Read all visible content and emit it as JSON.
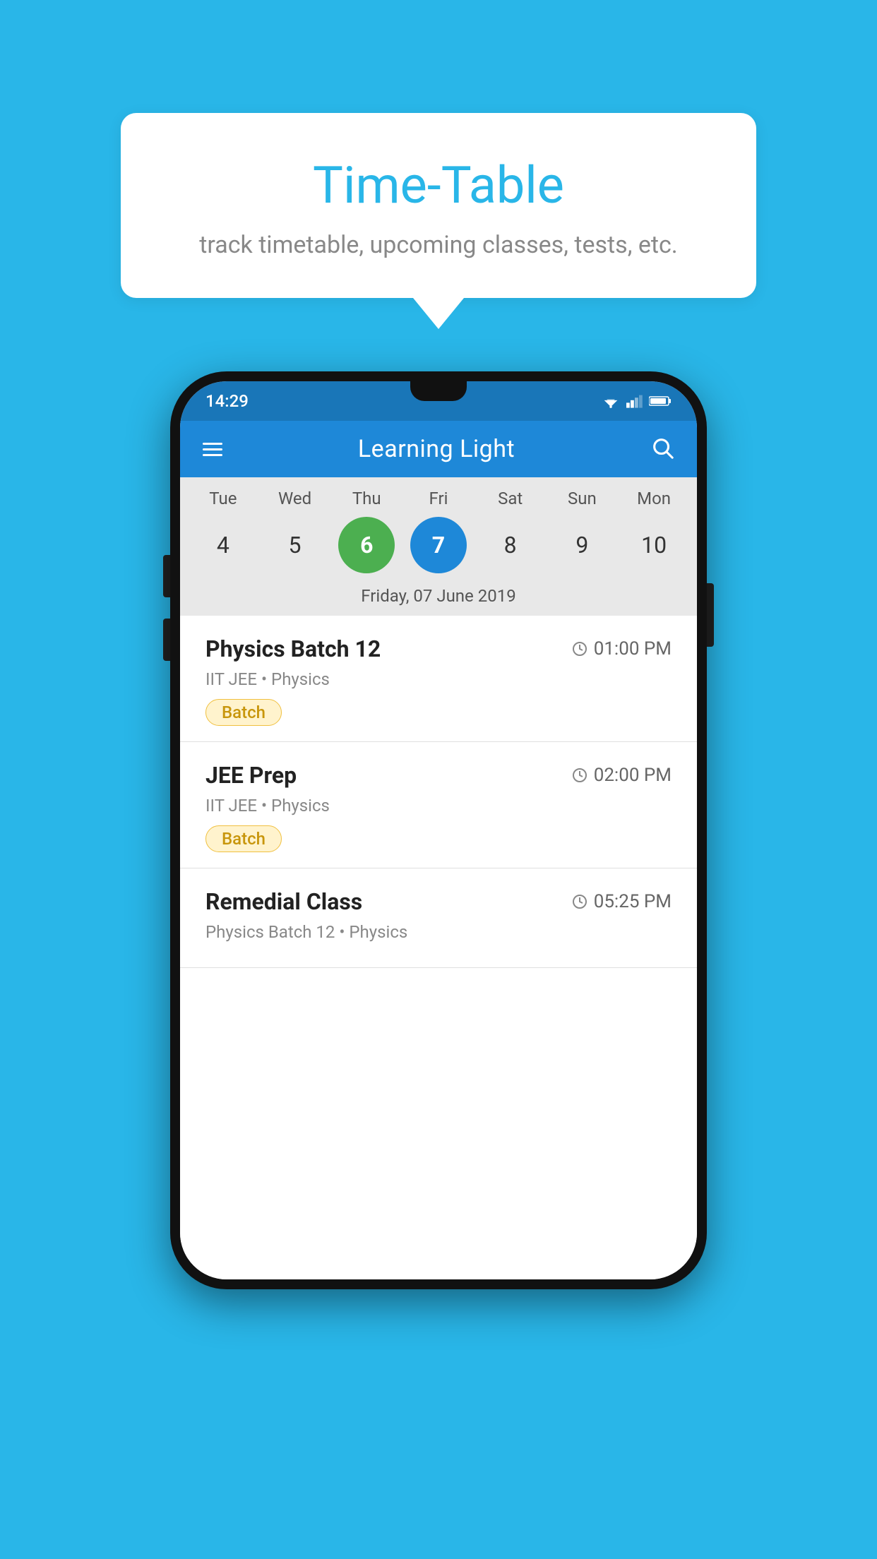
{
  "background_color": "#29B6E8",
  "speech_bubble": {
    "title": "Time-Table",
    "subtitle": "track timetable, upcoming classes, tests, etc."
  },
  "phone": {
    "status_bar": {
      "time": "14:29"
    },
    "app_bar": {
      "title": "Learning Light",
      "menu_icon_label": "menu-icon",
      "search_icon_label": "search-icon"
    },
    "calendar": {
      "days": [
        {
          "name": "Tue",
          "num": "4",
          "state": "normal"
        },
        {
          "name": "Wed",
          "num": "5",
          "state": "normal"
        },
        {
          "name": "Thu",
          "num": "6",
          "state": "today"
        },
        {
          "name": "Fri",
          "num": "7",
          "state": "selected"
        },
        {
          "name": "Sat",
          "num": "8",
          "state": "normal"
        },
        {
          "name": "Sun",
          "num": "9",
          "state": "normal"
        },
        {
          "name": "Mon",
          "num": "10",
          "state": "normal"
        }
      ],
      "selected_date_label": "Friday, 07 June 2019"
    },
    "classes": [
      {
        "title": "Physics Batch 12",
        "time": "01:00 PM",
        "subtitle": "IIT JEE • Physics",
        "badge": "Batch"
      },
      {
        "title": "JEE Prep",
        "time": "02:00 PM",
        "subtitle": "IIT JEE • Physics",
        "badge": "Batch"
      },
      {
        "title": "Remedial Class",
        "time": "05:25 PM",
        "subtitle": "Physics Batch 12 • Physics",
        "badge": null
      }
    ]
  }
}
